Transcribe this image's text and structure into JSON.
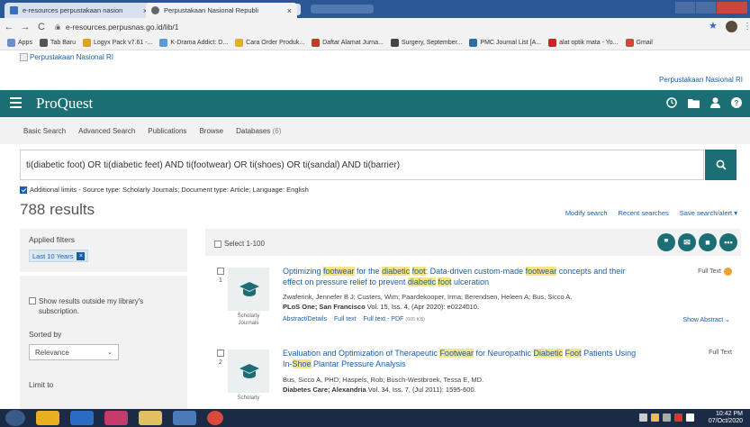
{
  "browser": {
    "tabs": [
      {
        "title": "e-resources perpustakaan nasion",
        "active": false
      },
      {
        "title": "Perpustakaan Nasional Republi",
        "active": true
      }
    ],
    "url": "e-resources.perpusnas.go.id/lib/1",
    "bookmarks": [
      {
        "label": "Apps",
        "color": "#6b8fc8"
      },
      {
        "label": "Tab Baru",
        "color": "#555555"
      },
      {
        "label": "Logyx Pack v7.61 -...",
        "color": "#e0a020"
      },
      {
        "label": "K-Drama Addict: D...",
        "color": "#5a9bd5"
      },
      {
        "label": "Cara Order Produk...",
        "color": "#e0b020"
      },
      {
        "label": "Daftar Alamat Jurna...",
        "color": "#c23b22"
      },
      {
        "label": "Surgery, September...",
        "color": "#444444"
      },
      {
        "label": "PMC Journal List [A...",
        "color": "#2d6da3"
      },
      {
        "label": "alat optik mata - Yo...",
        "color": "#d32020"
      },
      {
        "label": "Gmail",
        "color": "#d44638"
      }
    ]
  },
  "site": {
    "logo_alt": "Perpustakaan Nasional RI",
    "top_link": "Perpustakaan Nasional RI"
  },
  "proquest": {
    "title": "ProQuest",
    "nav": [
      "Basic Search",
      "Advanced Search",
      "Publications",
      "Browse",
      "Databases"
    ],
    "databases_count": "(6)",
    "query": "ti(diabetic foot) OR ti(diabetic feet) AND ti(footwear) OR ti(shoes) OR ti(sandal) AND ti(barrier)",
    "limits": "Additional limits - Source type: Scholarly Journals; Document type: Article; Language: English",
    "results_count": "788 results",
    "actions": [
      "Modify search",
      "Recent searches",
      "Save search/alert ▾"
    ]
  },
  "sidebar": {
    "applied_filters": "Applied filters",
    "filter_chip": "Last 10 Years",
    "show_outside": "Show results outside my library's subscription.",
    "sorted_by": "Sorted by",
    "sort_value": "Relevance",
    "limit_to": "Limit to"
  },
  "list": {
    "select_all": "Select 1-100"
  },
  "results": [
    {
      "num": "1",
      "title_parts": [
        {
          "t": "Optimizing ",
          "h": false
        },
        {
          "t": "footwear",
          "h": true
        },
        {
          "t": " for the ",
          "h": false
        },
        {
          "t": "diabetic",
          "h": true
        },
        {
          "t": " ",
          "h": false
        },
        {
          "t": "foot",
          "h": true
        },
        {
          "t": ": Data-driven custom-made ",
          "h": false
        },
        {
          "t": "footwear",
          "h": true
        },
        {
          "t": " concepts and their effect on pressure relief to prevent ",
          "h": false
        },
        {
          "t": "diabetic",
          "h": true
        },
        {
          "t": " ",
          "h": false
        },
        {
          "t": "foot",
          "h": true
        },
        {
          "t": " ulceration",
          "h": false
        }
      ],
      "authors": "Zwaferink, Jennefer B J; Custers, Wim; Paardekooper, Irma; Berendsen, Heleen A; Bus, Sicco A.",
      "source_bold": "PLoS One; San Francisco",
      "source_rest": " Vol. 15, Iss. 4,  (Apr 2020): e0224010.",
      "links": [
        "Abstract/Details",
        "Full text",
        "Full text - PDF"
      ],
      "pdf_size": "(605 KB)",
      "type": "Scholarly Journals",
      "fulltext": "Full Text",
      "show_abstract": "Show Abstract ⌄"
    },
    {
      "num": "2",
      "title_parts": [
        {
          "t": "Evaluation and Optimization of Therapeutic ",
          "h": false
        },
        {
          "t": "Footwear",
          "h": true
        },
        {
          "t": " for Neuropathic ",
          "h": false
        },
        {
          "t": "Diabetic",
          "h": true
        },
        {
          "t": " ",
          "h": false
        },
        {
          "t": "Foot",
          "h": true
        },
        {
          "t": " Patients Using In-",
          "h": false
        },
        {
          "t": "Shoe",
          "h": true
        },
        {
          "t": " Plantar Pressure Analysis",
          "h": false
        }
      ],
      "authors": "Bus, Sicco A, PHD; Haspels, Rob; Busch-Westbroek, Tessa E, MD.",
      "source_bold": "Diabetes Care; Alexandria",
      "source_rest": " Vol. 34, Iss. 7,  (Jul 2011): 1595-600.",
      "type": "Scholarly",
      "fulltext": "Full Text"
    }
  ],
  "taskbar": {
    "time": "10:42 PM",
    "date": "07/Oct/2020"
  }
}
